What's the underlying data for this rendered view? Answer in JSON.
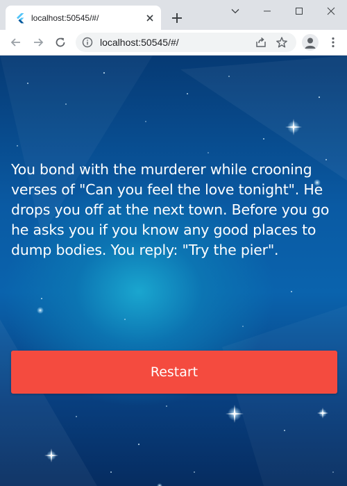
{
  "browser": {
    "tab": {
      "title": "localhost:50545/#/",
      "favicon": "flutter-icon",
      "close_icon": "close-icon"
    },
    "new_tab_icon": "plus-icon",
    "window_controls": [
      "chevron-down-icon",
      "minimize-icon",
      "maximize-icon",
      "close-icon"
    ],
    "toolbar": {
      "back_icon": "back-arrow-icon",
      "forward_icon": "forward-arrow-icon",
      "reload_icon": "reload-icon",
      "url": "localhost:50545/#/",
      "site_info_icon": "info-icon",
      "share_icon": "share-icon",
      "bookmark_icon": "star-icon",
      "profile_icon": "avatar-icon",
      "menu_icon": "kebab-menu-icon"
    }
  },
  "page": {
    "story_text": "You bond with the murderer while crooning verses of \"Can you feel the love tonight\". He drops you off at the next town. Before you go he asks you if you know any good places to dump bodies. You reply: \"Try the pier\".",
    "restart_label": "Restart",
    "colors": {
      "restart_button": "#f44b3f",
      "background_dark": "#063a74",
      "background_glow": "#1aa6cf",
      "text": "#ffffff"
    }
  }
}
